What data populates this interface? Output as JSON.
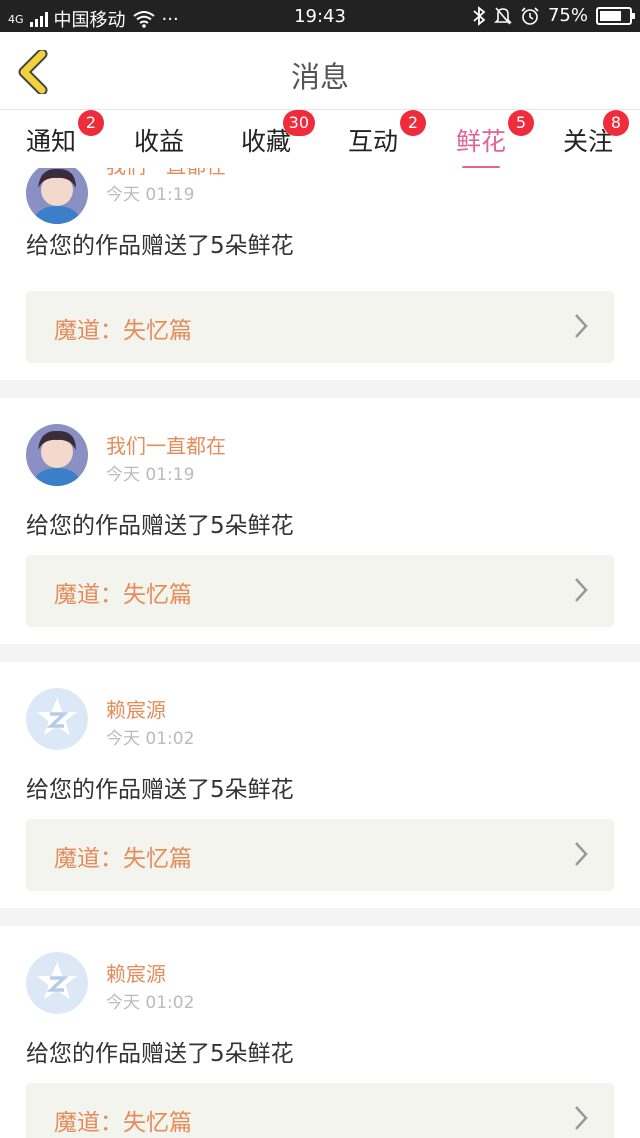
{
  "status_bar": {
    "network": "4G",
    "carrier": "中国移动",
    "dots": "···",
    "time": "19:43",
    "battery": "75%",
    "battery_level": 0.75
  },
  "header": {
    "title": "消息"
  },
  "tabs": [
    {
      "label": "通知",
      "badge": "2"
    },
    {
      "label": "收益",
      "badge": ""
    },
    {
      "label": "收藏",
      "badge": "30"
    },
    {
      "label": "互动",
      "badge": "2"
    },
    {
      "label": "鲜花",
      "badge": "5",
      "active": true
    },
    {
      "label": "关注",
      "badge": "8"
    }
  ],
  "messages": [
    {
      "username": "我们一直都在",
      "time": "今天 01:19",
      "text": "给您的作品赠送了5朵鲜花",
      "work": "魔道：失忆篇",
      "avatar": "photo-avatar"
    },
    {
      "username": "我们一直都在",
      "time": "今天 01:19",
      "text": "给您的作品赠送了5朵鲜花",
      "work": "魔道：失忆篇",
      "avatar": "photo-avatar"
    },
    {
      "username": "赖宸源",
      "time": "今天 01:02",
      "text": "给您的作品赠送了5朵鲜花",
      "work": "魔道：失忆篇",
      "avatar": "default-avatar"
    },
    {
      "username": "赖宸源",
      "time": "今天 01:02",
      "text": "给您的作品赠送了5朵鲜花",
      "work": "魔道：失忆篇",
      "avatar": "default-avatar"
    }
  ],
  "colors": {
    "accent": "#e06496",
    "badge": "#ee2c3c",
    "username": "#e48c5a",
    "back_arrow": "#f3d33a"
  }
}
